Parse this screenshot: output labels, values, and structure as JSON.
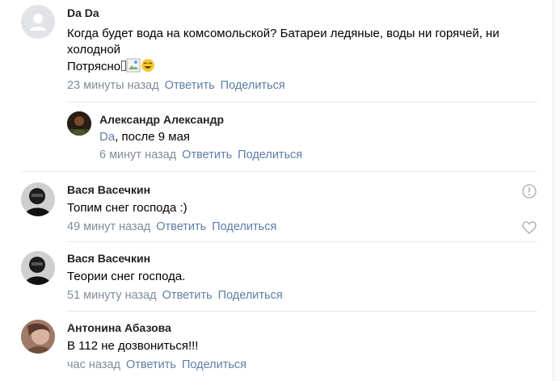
{
  "comments": [
    {
      "author": "Da Da",
      "text": "Когда будет вода на комсомольской? Батареи ледяные, воды ни горячей, ни холодной",
      "text_line2": "Потрясно",
      "time": "23 минуты назад",
      "reply_label": "Ответить",
      "share_label": "Поделиться"
    },
    {
      "author": "Александр Александр",
      "mention": "Da",
      "text": ", после 9 мая",
      "time": "6 минут назад",
      "reply_label": "Ответить",
      "share_label": "Поделиться"
    },
    {
      "author": "Вася Васечкин",
      "text": "Топим снег господа :)",
      "time": "49 минут назад",
      "reply_label": "Ответить",
      "share_label": "Поделиться"
    },
    {
      "author": "Вася Васечкин",
      "text": "Теории снег господа.",
      "time": "51 минуту назад",
      "reply_label": "Ответить",
      "share_label": "Поделиться"
    },
    {
      "author": "Антонина Абазова",
      "text": "В 112 не дозвониться!!!",
      "time": "час назад",
      "reply_label": "Ответить",
      "share_label": "Поделиться"
    }
  ],
  "colors": {
    "link": "#5d7ea6",
    "meta": "#818c99",
    "divider": "#e7e8ec"
  }
}
